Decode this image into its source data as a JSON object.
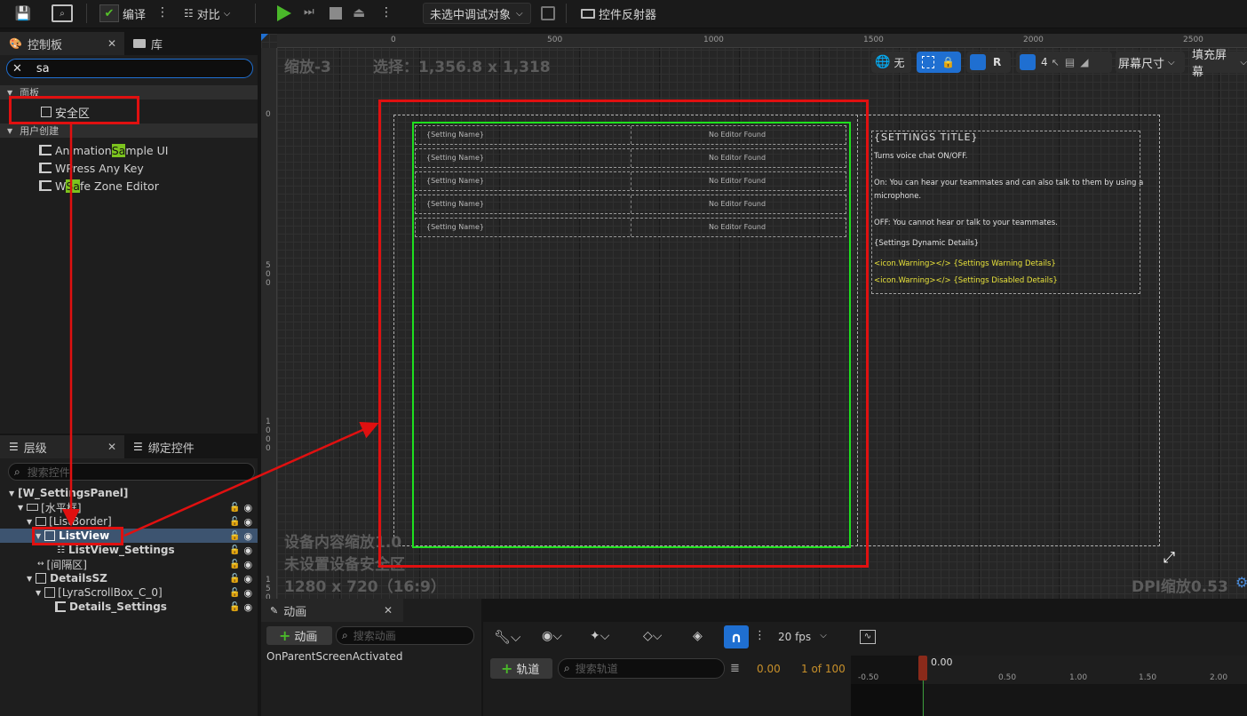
{
  "toolbar": {
    "compile_label": "编译",
    "diff_label": "对比",
    "debug_target": "未选中调试对象",
    "widget_reflector_label": "控件反射器"
  },
  "palette": {
    "tab_palette": "控制板",
    "tab_library": "库",
    "search_value": "sa",
    "category_panel": "面板",
    "safezone_item": "安全区",
    "category_user": "用户创建",
    "user_items": [
      {
        "pre": "Animation ",
        "hl": "Sa",
        "post": "mple UI"
      },
      {
        "pre": "W",
        "hl": "",
        "post": " Press Any Key"
      },
      {
        "pre": "W ",
        "hl": "Sa",
        "post": "fe Zone Editor"
      }
    ]
  },
  "hierarchy": {
    "tab_hierarchy": "层级",
    "tab_bind": "绑定控件",
    "search_placeholder": "搜索控件",
    "nodes": [
      "[W_SettingsPanel]",
      "[水平框]",
      "[ListBorder]",
      "ListView",
      "ListView_Settings",
      "[间隔区]",
      "DetailsSZ",
      "[LyraScrollBox_C_0]",
      "Details_Settings"
    ]
  },
  "designer": {
    "zoom_text": "缩放-3",
    "selection_text": "选择：1,356.8 x 1,318",
    "none_label": "无",
    "r_label": "R",
    "grid_value": "4",
    "screen_size_label": "屏幕尺寸",
    "fill_screen_label": "填充屏幕",
    "ruler_h": [
      "0",
      "500",
      "1000",
      "1500",
      "2000",
      "2500"
    ],
    "ruler_v": [
      "0",
      "500",
      "1000",
      "150"
    ],
    "device_scale": "设备内容缩放1.0",
    "no_safezone": "未设置设备安全区",
    "resolution": "1280 x 720（16:9）",
    "dpi": "DPI缩放0.53",
    "setting_name": "{Setting Name}",
    "no_editor": "No Editor Found",
    "details": {
      "title": "{SETTINGS TITLE}",
      "line1": "Turns voice chat ON/OFF.",
      "line2": "On: You can hear your teammates and can also talk to them by using a",
      "line3": "microphone.",
      "line4": "OFF: You cannot hear or talk to your teammates.",
      "line5": "{Settings Dynamic Details}",
      "warn1": "<icon.Warning></> {Settings Warning Details}",
      "warn2": "<icon.Warning></> {Settings Disabled Details}"
    }
  },
  "animation": {
    "tab_label": "动画",
    "add_anim": "动画",
    "search_anim_placeholder": "搜索动画",
    "anim_item": "OnParentScreenActivated",
    "fps": "20 fps",
    "add_track": "轨道",
    "search_track_placeholder": "搜索轨道",
    "time_value": "0.00",
    "frame_of": "1 of 100",
    "timeline_time": "0.00",
    "timeline_ticks": [
      "-0.50",
      "0.50",
      "1.00",
      "1.50",
      "2.00"
    ]
  },
  "colors": {
    "accent_blue": "#1f6fd1",
    "annotation_red": "#e01010",
    "safezone_green": "#1ee01e",
    "search_highlight": "#7cc41e"
  }
}
